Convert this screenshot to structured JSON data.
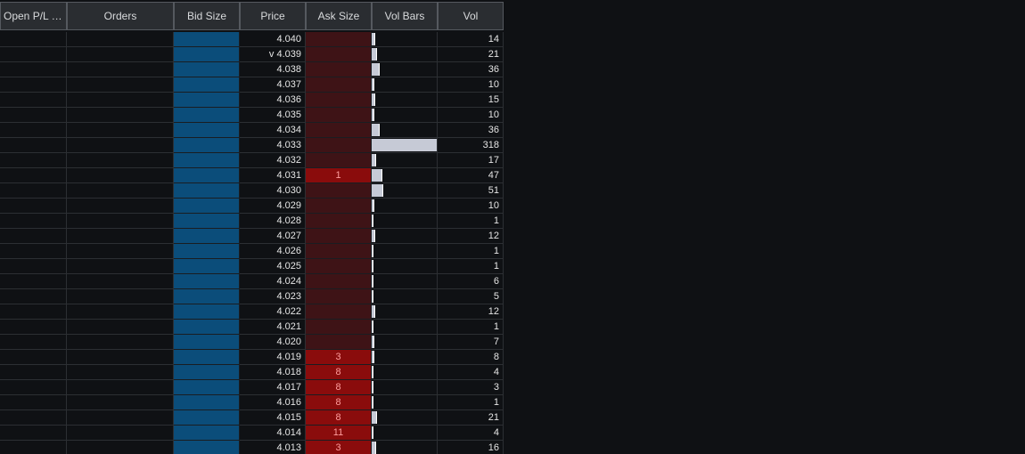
{
  "headers": {
    "open_pl": "Open P/L (U...",
    "orders": "Orders",
    "bid_size": "Bid Size",
    "price": "Price",
    "ask_size": "Ask Size",
    "vol_bars": "Vol Bars",
    "vol": "Vol"
  },
  "colors": {
    "background": "#0f1114",
    "bid_cell": "#0b4d7a",
    "ask_cell_empty": "#3e1316",
    "ask_cell_filled": "#8a0c0c",
    "ask_text": "#ff9d9d",
    "vol_bar": "#c6cad6",
    "header_bg": "#2a2d31"
  },
  "vol_bar_max": 318,
  "rows": [
    {
      "price": "4.040",
      "ask": "",
      "vol": "14"
    },
    {
      "price": "v 4.039",
      "ask": "",
      "vol": "21"
    },
    {
      "price": "4.038",
      "ask": "",
      "vol": "36"
    },
    {
      "price": "4.037",
      "ask": "",
      "vol": "10"
    },
    {
      "price": "4.036",
      "ask": "",
      "vol": "15"
    },
    {
      "price": "4.035",
      "ask": "",
      "vol": "10"
    },
    {
      "price": "4.034",
      "ask": "",
      "vol": "36"
    },
    {
      "price": "4.033",
      "ask": "",
      "vol": "318"
    },
    {
      "price": "4.032",
      "ask": "",
      "vol": "17"
    },
    {
      "price": "4.031",
      "ask": "1",
      "vol": "47"
    },
    {
      "price": "4.030",
      "ask": "",
      "vol": "51"
    },
    {
      "price": "4.029",
      "ask": "",
      "vol": "10"
    },
    {
      "price": "4.028",
      "ask": "",
      "vol": "1"
    },
    {
      "price": "4.027",
      "ask": "",
      "vol": "12"
    },
    {
      "price": "4.026",
      "ask": "",
      "vol": "1"
    },
    {
      "price": "4.025",
      "ask": "",
      "vol": "1"
    },
    {
      "price": "4.024",
      "ask": "",
      "vol": "6"
    },
    {
      "price": "4.023",
      "ask": "",
      "vol": "5"
    },
    {
      "price": "4.022",
      "ask": "",
      "vol": "12"
    },
    {
      "price": "4.021",
      "ask": "",
      "vol": "1"
    },
    {
      "price": "4.020",
      "ask": "",
      "vol": "7"
    },
    {
      "price": "4.019",
      "ask": "3",
      "vol": "8"
    },
    {
      "price": "4.018",
      "ask": "8",
      "vol": "4"
    },
    {
      "price": "4.017",
      "ask": "8",
      "vol": "3"
    },
    {
      "price": "4.016",
      "ask": "8",
      "vol": "1"
    },
    {
      "price": "4.015",
      "ask": "8",
      "vol": "21"
    },
    {
      "price": "4.014",
      "ask": "11",
      "vol": "4"
    },
    {
      "price": "4.013",
      "ask": "3",
      "vol": "16"
    }
  ]
}
